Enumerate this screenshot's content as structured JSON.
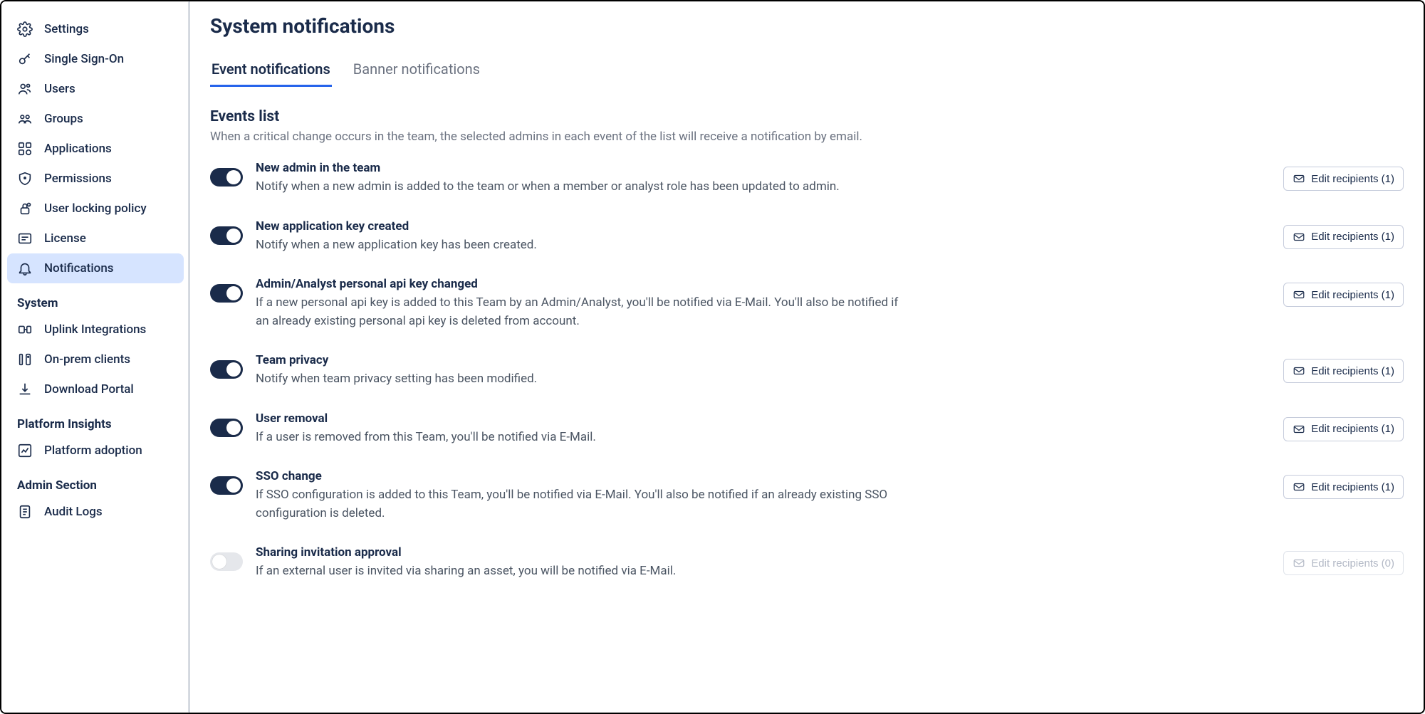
{
  "sidebar": {
    "groups": [
      {
        "header": null,
        "items": [
          {
            "id": "settings",
            "icon": "gear-icon",
            "label": "Settings",
            "active": false
          },
          {
            "id": "sso",
            "icon": "key-icon",
            "label": "Single Sign-On",
            "active": false
          },
          {
            "id": "users",
            "icon": "users-icon",
            "label": "Users",
            "active": false
          },
          {
            "id": "groups",
            "icon": "groups-icon",
            "label": "Groups",
            "active": false
          },
          {
            "id": "applications",
            "icon": "apps-icon",
            "label": "Applications",
            "active": false
          },
          {
            "id": "permissions",
            "icon": "shield-icon",
            "label": "Permissions",
            "active": false
          },
          {
            "id": "user-locking",
            "icon": "lock-icon",
            "label": "User locking policy",
            "active": false
          },
          {
            "id": "license",
            "icon": "license-icon",
            "label": "License",
            "active": false
          },
          {
            "id": "notifications",
            "icon": "bell-icon",
            "label": "Notifications",
            "active": true
          }
        ]
      },
      {
        "header": "System",
        "items": [
          {
            "id": "uplink",
            "icon": "uplink-icon",
            "label": "Uplink Integrations",
            "active": false
          },
          {
            "id": "onprem",
            "icon": "server-icon",
            "label": "On-prem clients",
            "active": false
          },
          {
            "id": "download",
            "icon": "download-icon",
            "label": "Download Portal",
            "active": false
          }
        ]
      },
      {
        "header": "Platform Insights",
        "items": [
          {
            "id": "adoption",
            "icon": "chart-icon",
            "label": "Platform adoption",
            "active": false
          }
        ]
      },
      {
        "header": "Admin Section",
        "items": [
          {
            "id": "audit",
            "icon": "log-icon",
            "label": "Audit Logs",
            "active": false
          }
        ]
      }
    ]
  },
  "page": {
    "title": "System notifications",
    "tabs": [
      {
        "id": "event",
        "label": "Event notifications",
        "active": true
      },
      {
        "id": "banner",
        "label": "Banner notifications",
        "active": false
      }
    ],
    "events_heading": "Events list",
    "events_desc": "When a critical change occurs in the team, the selected admins in each event of the list will receive a notification by email.",
    "edit_label": "Edit recipients",
    "events": [
      {
        "title": "New admin in the team",
        "desc": "Notify when a new admin is added to the team or when a member or analyst role has been updated to admin.",
        "enabled": true,
        "recipients": 1
      },
      {
        "title": "New application key created",
        "desc": "Notify when a new application key has been created.",
        "enabled": true,
        "recipients": 1
      },
      {
        "title": "Admin/Analyst personal api key changed",
        "desc": "If a new personal api key is added to this Team by an Admin/Analyst, you'll be notified via E-Mail. You'll also be notified if an already existing personal api key is deleted from account.",
        "enabled": true,
        "recipients": 1
      },
      {
        "title": "Team privacy",
        "desc": "Notify when team privacy setting has been modified.",
        "enabled": true,
        "recipients": 1
      },
      {
        "title": "User removal",
        "desc": "If a user is removed from this Team, you'll be notified via E-Mail.",
        "enabled": true,
        "recipients": 1
      },
      {
        "title": "SSO change",
        "desc": "If SSO configuration is added to this Team, you'll be notified via E-Mail. You'll also be notified if an already existing SSO configuration is deleted.",
        "enabled": true,
        "recipients": 1
      },
      {
        "title": "Sharing invitation approval",
        "desc": "If an external user is invited via sharing an asset, you will be notified via E-Mail.",
        "enabled": false,
        "recipients": 0
      }
    ]
  }
}
